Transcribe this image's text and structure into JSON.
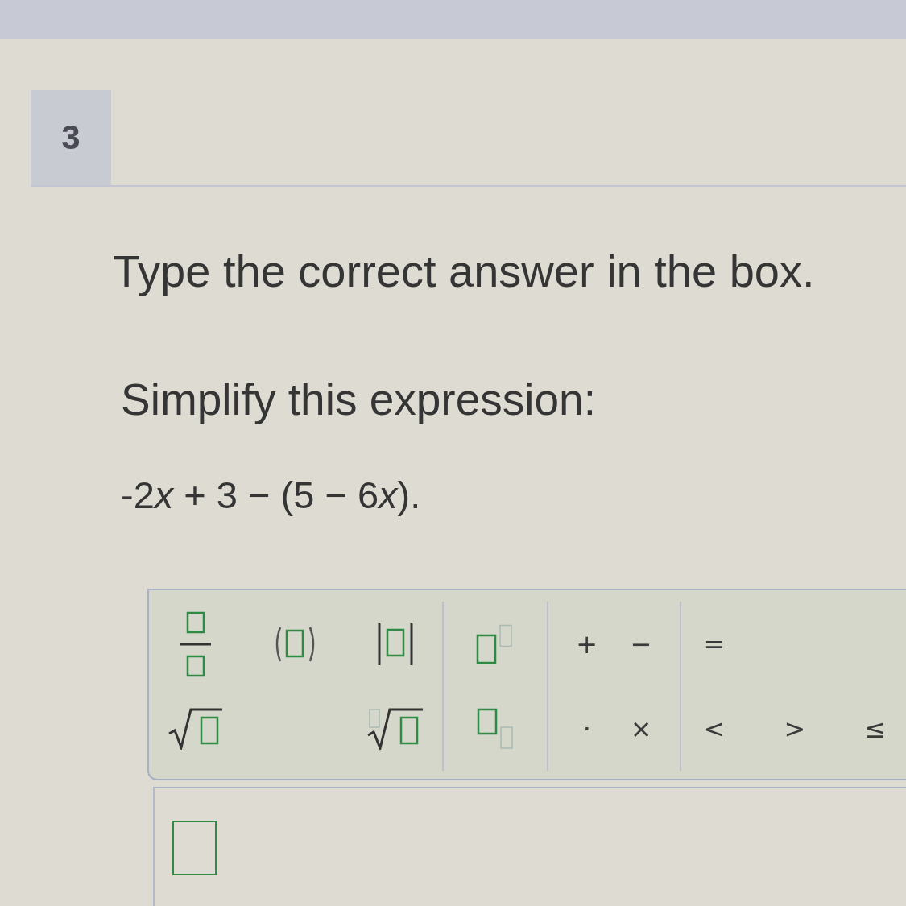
{
  "question": {
    "number": "3",
    "instruction": "Type the correct answer in the box.",
    "prompt": "Simplify this expression:",
    "expression": [
      {
        "text": "-2",
        "italic": false
      },
      {
        "text": "x",
        "italic": true
      },
      {
        "text": " + 3 − (5 − 6",
        "italic": false
      },
      {
        "text": "x",
        "italic": true
      },
      {
        "text": ").",
        "italic": false
      }
    ]
  },
  "math_toolbar": {
    "groups": [
      {
        "rows": [
          [
            {
              "kind": "fraction"
            },
            {
              "kind": "parentheses"
            },
            {
              "kind": "absolute_value"
            }
          ],
          [
            {
              "kind": "square_root"
            },
            {
              "kind": "nth_root"
            }
          ]
        ]
      },
      {
        "rows": [
          [
            {
              "kind": "superscript"
            }
          ],
          [
            {
              "kind": "subscript"
            }
          ]
        ]
      },
      {
        "rows": [
          [
            {
              "kind": "symbol",
              "symbol": "+"
            },
            {
              "kind": "symbol",
              "symbol": "−"
            }
          ],
          [
            {
              "kind": "symbol",
              "symbol": "·"
            },
            {
              "kind": "symbol",
              "symbol": "×"
            }
          ]
        ]
      },
      {
        "rows": [
          [
            {
              "kind": "symbol",
              "symbol": "="
            }
          ],
          [
            {
              "kind": "symbol",
              "symbol": "<"
            },
            {
              "kind": "symbol",
              "symbol": ">"
            },
            {
              "kind": "symbol",
              "symbol": "≤"
            }
          ]
        ]
      }
    ]
  }
}
